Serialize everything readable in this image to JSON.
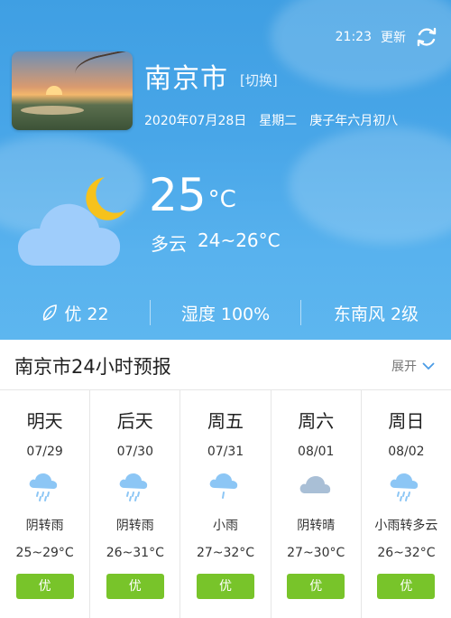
{
  "status": {
    "time": "21:23",
    "refresh_label": "更新"
  },
  "location": {
    "city": "南京市",
    "switch_label": "[切换]"
  },
  "date": {
    "gregorian": "2020年07月28日",
    "weekday": "星期二",
    "lunar": "庚子年六月初八"
  },
  "current": {
    "temperature": "25",
    "unit": "°C",
    "condition": "多云",
    "range": "24~26°C",
    "icon": "cloudy-night-icon"
  },
  "stats": {
    "aqi": "优 22",
    "humidity": "湿度 100%",
    "wind": "东南风 2级"
  },
  "forecast": {
    "title": "南京市24小时预报",
    "expand_label": "展开",
    "days": [
      {
        "name": "明天",
        "date": "07/29",
        "condition": "阴转雨",
        "temp": "25~29°C",
        "aqi": "优",
        "icon": "rain-icon"
      },
      {
        "name": "后天",
        "date": "07/30",
        "condition": "阴转雨",
        "temp": "26~31°C",
        "aqi": "优",
        "icon": "rain-icon"
      },
      {
        "name": "周五",
        "date": "07/31",
        "condition": "小雨",
        "temp": "27~32°C",
        "aqi": "优",
        "icon": "light-rain-icon"
      },
      {
        "name": "周六",
        "date": "08/01",
        "condition": "阴转晴",
        "temp": "27~30°C",
        "aqi": "优",
        "icon": "overcast-icon"
      },
      {
        "name": "周日",
        "date": "08/02",
        "condition": "小雨转多云",
        "temp": "26~32°C",
        "aqi": "优",
        "icon": "rain-icon"
      }
    ]
  },
  "colors": {
    "sky": "#48a6e8",
    "aqi_good": "#78c42a",
    "moon": "#f6c21c",
    "cloud": "#9fcdfb"
  }
}
